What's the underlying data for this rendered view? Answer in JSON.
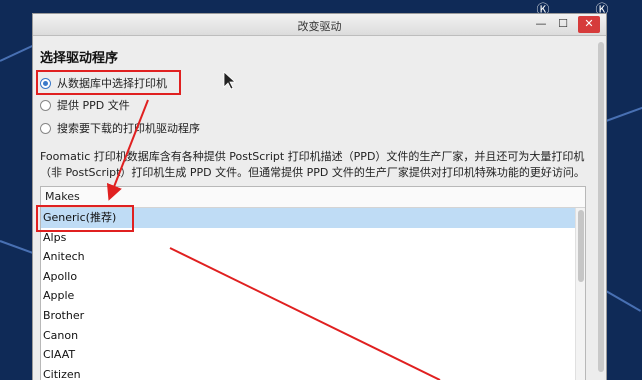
{
  "window": {
    "title": "改变驱动",
    "controls": {
      "minimize": "—",
      "maximize": "☐",
      "close": "✕"
    }
  },
  "heading": "选择驱动程序",
  "options": [
    {
      "label": "从数据库中选择打印机",
      "checked": true
    },
    {
      "label": "提供 PPD 文件",
      "checked": false
    },
    {
      "label": "搜索要下载的打印机驱动程序",
      "checked": false
    }
  ],
  "description": "Foomatic 打印机数据库含有各种提供 PostScript 打印机描述（PPD）文件的生产厂家，并且还可为大量打印机（非 PostScript）打印机生成 PPD 文件。但通常提供 PPD 文件的生产厂家提供对打印机特殊功能的更好访问。",
  "makes": {
    "header": "Makes",
    "items": [
      "Generic(推荐)",
      "Alps",
      "Anitech",
      "Apollo",
      "Apple",
      "Brother",
      "Canon",
      "CIAAT",
      "Citizen"
    ],
    "selected_index": 0
  },
  "colors": {
    "annotation": "#e02020",
    "selection": "#bfdcf5",
    "radio_accent": "#3a79c9",
    "close_button": "#d63b3b"
  }
}
